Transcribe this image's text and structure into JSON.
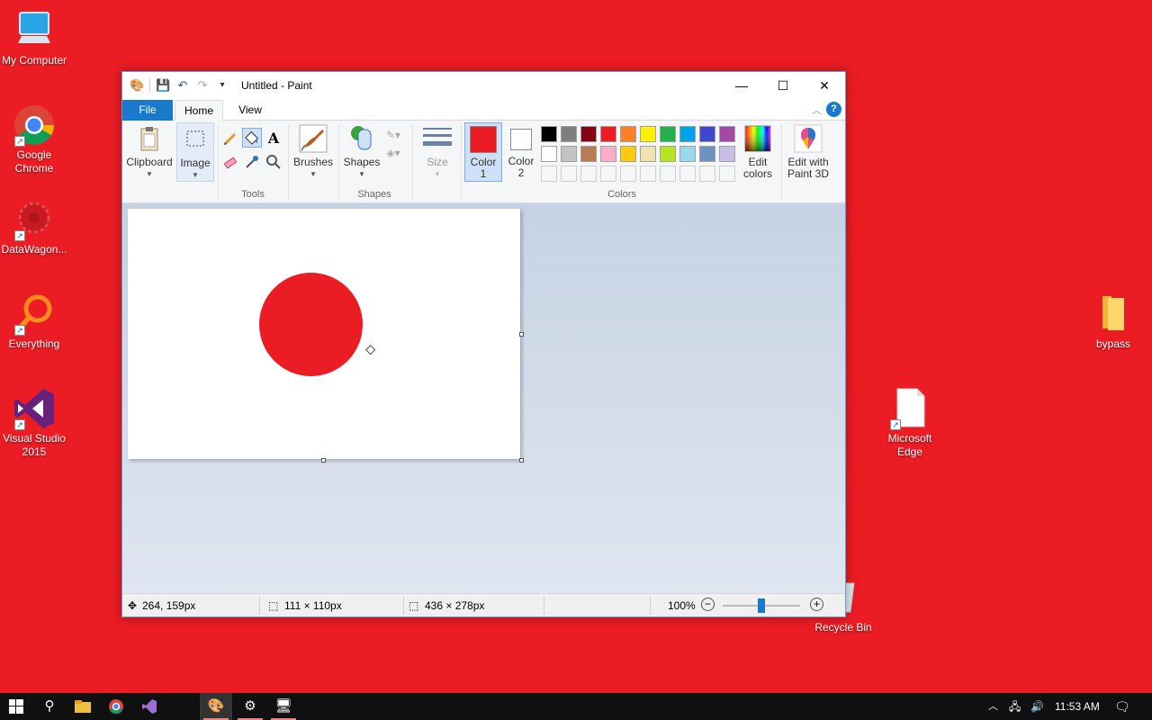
{
  "desktop": {
    "icons": [
      {
        "label": "My Computer",
        "icon": "computer-icon"
      },
      {
        "label": "Google Chrome",
        "icon": "chrome-icon"
      },
      {
        "label": "DataWagon...",
        "icon": "datawagon-icon"
      },
      {
        "label": "Everything",
        "icon": "search-magnifier-icon"
      },
      {
        "label": "Visual Studio 2015",
        "icon": "visual-studio-icon"
      },
      {
        "label": "bypass",
        "icon": "folder-icon"
      },
      {
        "label": "Microsoft Edge",
        "icon": "file-icon"
      },
      {
        "label": "Recycle Bin",
        "icon": "recycle-bin-icon"
      }
    ],
    "background_color": "#ec1c24"
  },
  "window": {
    "title": "Untitled - Paint",
    "controls": {
      "minimize": "—",
      "maximize": "☐",
      "close": "✕"
    }
  },
  "tabs": {
    "file": "File",
    "home": "Home",
    "view": "View",
    "help": "?"
  },
  "ribbon": {
    "clipboard": "Clipboard",
    "image": "Image",
    "tools": "Tools",
    "brushes": "Brushes",
    "shapes_btn": "Shapes",
    "shapes_group": "Shapes",
    "size": "Size",
    "color1": "Color",
    "color1_num": "1",
    "color2": "Color",
    "color2_num": "2",
    "edit_colors_1": "Edit",
    "edit_colors_2": "colors",
    "paint3d_1": "Edit with",
    "paint3d_2": "Paint 3D",
    "colors_group": "Colors",
    "color1_value": "#ec1c24",
    "color2_value": "#ffffff",
    "palette_row1": [
      "#000000",
      "#7f7f7f",
      "#880015",
      "#ed1c24",
      "#ff7f27",
      "#fff200",
      "#22b14c",
      "#00a2e8",
      "#3f48cc",
      "#a349a4"
    ],
    "palette_row2": [
      "#ffffff",
      "#c3c3c3",
      "#b97a57",
      "#ffaec9",
      "#ffc90e",
      "#efe4b0",
      "#b5e61d",
      "#99d9ea",
      "#7092be",
      "#c8bfe7"
    ]
  },
  "statusbar": {
    "cursor_pos": "264, 159px",
    "selection_size": "111 × 110px",
    "canvas_size": "436 × 278px",
    "zoom": "100%",
    "zoom_level": 0.5
  },
  "taskbar": {
    "time": "11:53 AM"
  }
}
